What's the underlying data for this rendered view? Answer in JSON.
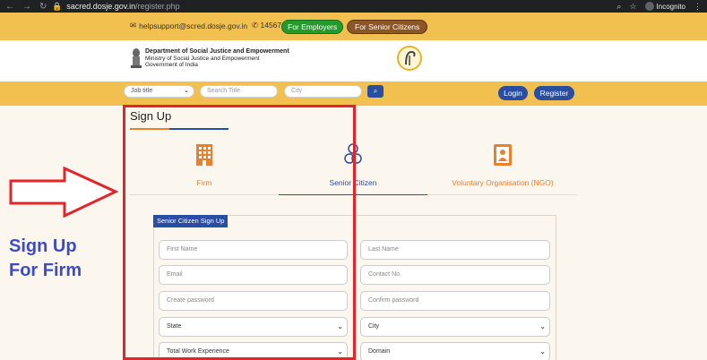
{
  "browser": {
    "url_host": "sacred.dosje.gov.in",
    "url_path": "/register.php",
    "incognito_label": "Incognito"
  },
  "topbar": {
    "email": "helpsupport@scred.dosje.gov.in",
    "phone": "14567",
    "for_employers": "For Employers",
    "for_senior_citizens": "For Senior Citizens"
  },
  "header": {
    "dept_line1": "Department of Social Justice and Empowerment",
    "dept_line2": "Ministry of Social Justice and Empowerment",
    "dept_line3": "Government of India"
  },
  "search": {
    "job_title_selected": "Job title",
    "search_title_placeholder": "Search Title",
    "city_placeholder": "City",
    "login": "Login",
    "register": "Register"
  },
  "signup": {
    "title": "Sign Up",
    "tabs": [
      {
        "label": "Firm",
        "active": false
      },
      {
        "label": "Senior Citizen",
        "active": true
      },
      {
        "label": "Voluntary Organisation (NGO)",
        "active": false
      }
    ],
    "form_header": "Senior Citizen Sign Up",
    "fields": {
      "first_name": "First Name",
      "last_name": "Last Name",
      "email": "Email",
      "contact_no": "Contact No.",
      "create_password": "Create password",
      "confirm_password": "Confirm password",
      "state": "State",
      "city": "City",
      "total_work_experience": "Total Work Experience",
      "domain": "Domain"
    }
  },
  "annotation": {
    "line1": "Sign Up",
    "line2": "For Firm"
  },
  "colors": {
    "yellow": "#f1c04f",
    "blue": "#284da1",
    "orange": "#e9802e",
    "green": "#239b2a",
    "brown": "#8d5626",
    "red_annotation": "#e3242b"
  }
}
